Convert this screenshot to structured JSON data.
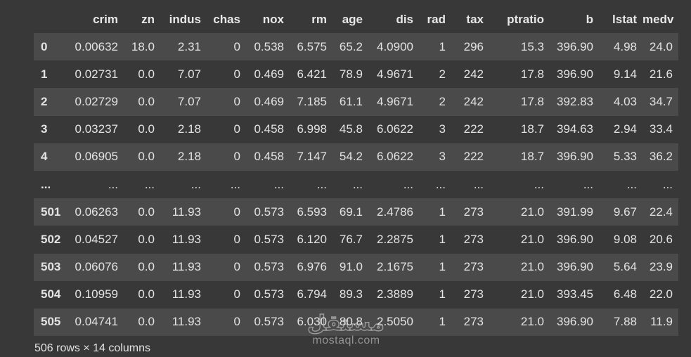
{
  "dataframe": {
    "columns": [
      "",
      "crim",
      "zn",
      "indus",
      "chas",
      "nox",
      "rm",
      "age",
      "dis",
      "rad",
      "tax",
      "ptratio",
      "b",
      "lstat",
      "medv"
    ],
    "rows": [
      [
        "0",
        "0.00632",
        "18.0",
        "2.31",
        "0",
        "0.538",
        "6.575",
        "65.2",
        "4.0900",
        "1",
        "296",
        "15.3",
        "396.90",
        "4.98",
        "24.0"
      ],
      [
        "1",
        "0.02731",
        "0.0",
        "7.07",
        "0",
        "0.469",
        "6.421",
        "78.9",
        "4.9671",
        "2",
        "242",
        "17.8",
        "396.90",
        "9.14",
        "21.6"
      ],
      [
        "2",
        "0.02729",
        "0.0",
        "7.07",
        "0",
        "0.469",
        "7.185",
        "61.1",
        "4.9671",
        "2",
        "242",
        "17.8",
        "392.83",
        "4.03",
        "34.7"
      ],
      [
        "3",
        "0.03237",
        "0.0",
        "2.18",
        "0",
        "0.458",
        "6.998",
        "45.8",
        "6.0622",
        "3",
        "222",
        "18.7",
        "394.63",
        "2.94",
        "33.4"
      ],
      [
        "4",
        "0.06905",
        "0.0",
        "2.18",
        "0",
        "0.458",
        "7.147",
        "54.2",
        "6.0622",
        "3",
        "222",
        "18.7",
        "396.90",
        "5.33",
        "36.2"
      ],
      [
        "...",
        "...",
        "...",
        "...",
        "...",
        "...",
        "...",
        "...",
        "...",
        "...",
        "...",
        "...",
        "...",
        "...",
        "..."
      ],
      [
        "501",
        "0.06263",
        "0.0",
        "11.93",
        "0",
        "0.573",
        "6.593",
        "69.1",
        "2.4786",
        "1",
        "273",
        "21.0",
        "391.99",
        "9.67",
        "22.4"
      ],
      [
        "502",
        "0.04527",
        "0.0",
        "11.93",
        "0",
        "0.573",
        "6.120",
        "76.7",
        "2.2875",
        "1",
        "273",
        "21.0",
        "396.90",
        "9.08",
        "20.6"
      ],
      [
        "503",
        "0.06076",
        "0.0",
        "11.93",
        "0",
        "0.573",
        "6.976",
        "91.0",
        "2.1675",
        "1",
        "273",
        "21.0",
        "396.90",
        "5.64",
        "23.9"
      ],
      [
        "504",
        "0.10959",
        "0.0",
        "11.93",
        "0",
        "0.573",
        "6.794",
        "89.3",
        "2.3889",
        "1",
        "273",
        "21.0",
        "393.45",
        "6.48",
        "22.0"
      ],
      [
        "505",
        "0.04741",
        "0.0",
        "11.93",
        "0",
        "0.573",
        "6.030",
        "80.8",
        "2.5050",
        "1",
        "273",
        "21.0",
        "396.90",
        "7.88",
        "11.9"
      ]
    ],
    "summary": "506 rows × 14 columns"
  },
  "watermark": {
    "arabic_text": "مستقل",
    "latin_text": "mostaql.com"
  },
  "colors": {
    "background": "#383838",
    "row_stripe": "#4a4a4a",
    "text": "#e3e3e3"
  }
}
